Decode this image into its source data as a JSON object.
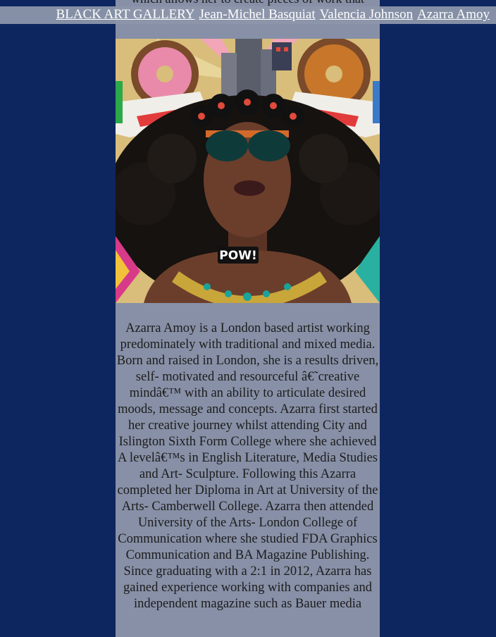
{
  "nav": {
    "links": [
      "BLACK ART GALLERY",
      "Jean-Michel Basquiat",
      "Valencia Johnson",
      "Azarra Amoy"
    ]
  },
  "page": {
    "top_text": "which allows her to create pieces of work that",
    "artwork_badge_text": "POW!",
    "bio": "Azarra Amoy is a London based artist working predominately with traditional and mixed media. Born and raised in London, she is a results driven, self- motivated and resourceful â€˜creative mindâ€™ with an ability to articulate desired moods, message and concepts. Azarra first started her creative journey whilst attending City and Islington Sixth Form College where she achieved A levelâ€™s in English Literature, Media Studies and Art- Sculpture. Following this Azarra completed her Diploma in Art at University of the Arts- Camberwell College. Azarra then attended University of the Arts- London College of Communication where she studied FDA Graphics Communication and BA Magazine Publishing. Since graduating with a 2:1 in 2012, Azarra has gained experience working with companies and independent magazine such as Bauer media"
  },
  "colors": {
    "page_background": "#0e2660",
    "column_background": "#8790a6",
    "navbar_background": "#8c96aa",
    "link_color": "#ffffff"
  }
}
